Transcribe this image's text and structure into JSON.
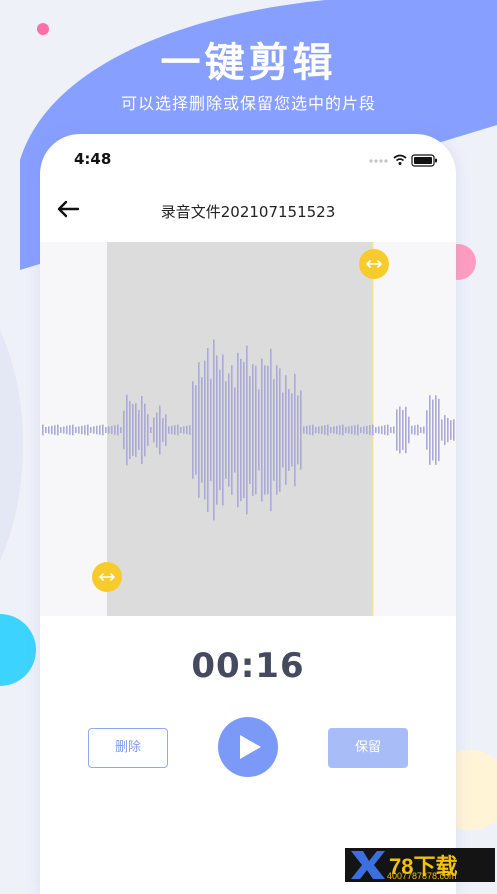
{
  "promo": {
    "title": "一键剪辑",
    "subtitle": "可以选择删除或保留您选中的片段"
  },
  "status_bar": {
    "time": "4:48"
  },
  "header": {
    "title": "录音文件202107151523"
  },
  "editor": {
    "selection_color": "#dcdcdc",
    "waveform_color": "#aaaad6",
    "handle_color": "#f8cb2c"
  },
  "player": {
    "elapsed": "00:16",
    "delete_label": "删除",
    "keep_label": "保留",
    "accent": "#7b9af7"
  },
  "watermark": {
    "brand": "78下载",
    "url": "4007787878.com"
  }
}
